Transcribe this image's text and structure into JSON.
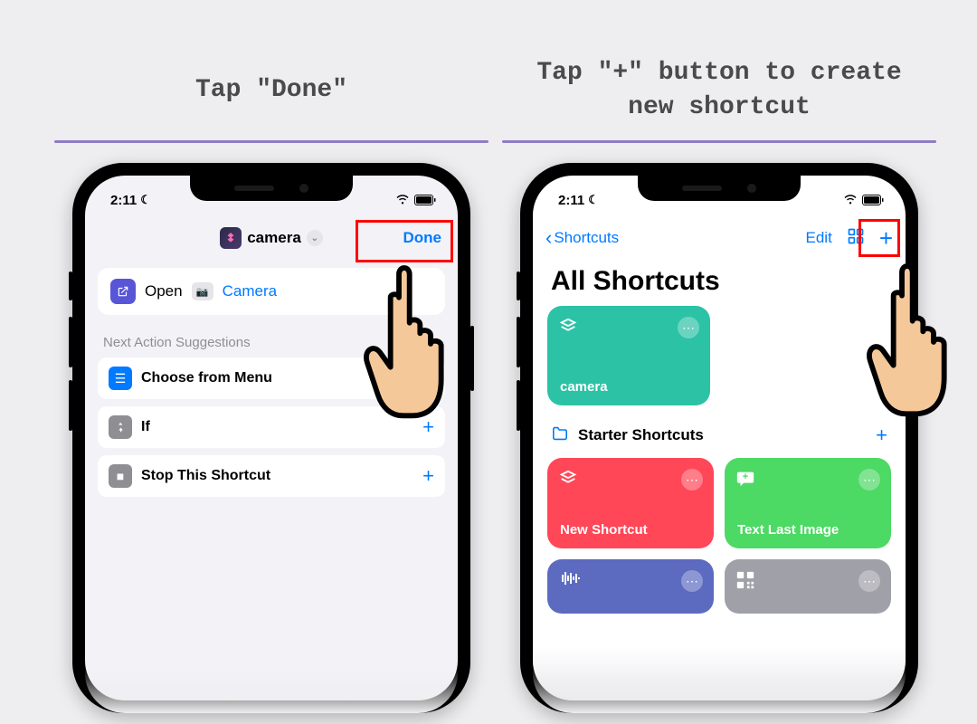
{
  "captions": {
    "left": "Tap \"Done\"",
    "right": "Tap \"+\" button to create new shortcut"
  },
  "status": {
    "time": "2:11"
  },
  "left_phone": {
    "shortcut_name": "camera",
    "done_label": "Done",
    "open_label": "Open",
    "open_target": "Camera",
    "suggestions_header": "Next Action Suggestions",
    "suggestions": [
      {
        "label": "Choose from Menu",
        "icon_color": "blue"
      },
      {
        "label": "If",
        "icon_color": "gray"
      },
      {
        "label": "Stop This Shortcut",
        "icon_color": "gray"
      }
    ]
  },
  "right_phone": {
    "back_label": "Shortcuts",
    "edit_label": "Edit",
    "page_title": "All Shortcuts",
    "camera_tile": "camera",
    "folder_label": "Starter Shortcuts",
    "tiles": [
      {
        "label": "New Shortcut",
        "color": "red"
      },
      {
        "label": "Text Last Image",
        "color": "green"
      }
    ]
  }
}
